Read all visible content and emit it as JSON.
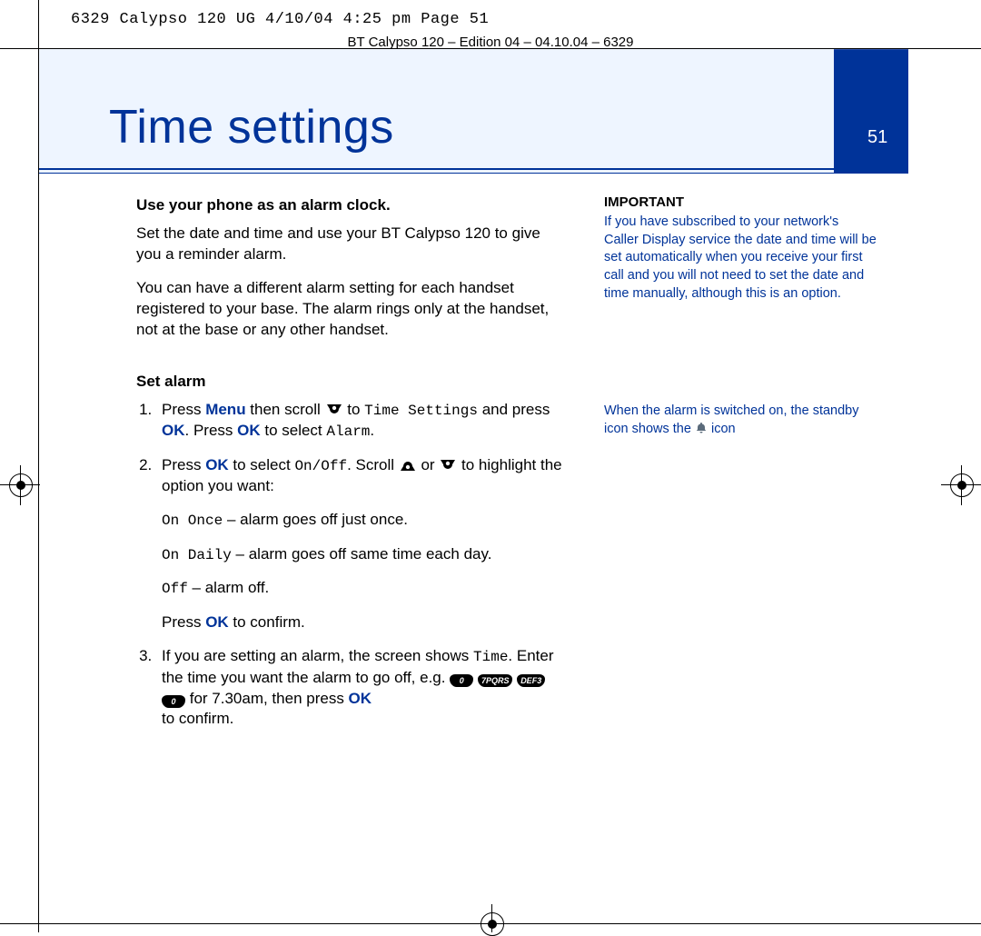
{
  "slug": "6329 Calypso 120 UG   4/10/04  4:25 pm  Page 51",
  "running_head": "BT Calypso 120 – Edition 04 – 04.10.04 – 6329",
  "banner": {
    "title": "Time settings",
    "page_number": "51"
  },
  "main": {
    "h1": "Use your phone as an alarm clock.",
    "p1": "Set the date and time and use your BT Calypso 120 to give you a reminder alarm.",
    "p2": "You can have a different alarm setting for each handset registered to your base. The alarm rings only at the handset, not at the base or any other handset.",
    "h2": "Set alarm",
    "step1_a": "Press ",
    "step1_menu": "Menu",
    "step1_b": " then scroll ",
    "step1_c": " to ",
    "step1_menu_item": "Time Settings",
    "step1_d": " and press ",
    "step1_ok1": "OK",
    "step1_e": ". Press ",
    "step1_ok2": "OK",
    "step1_f": " to select ",
    "step1_alarm": "Alarm",
    "step1_g": ".",
    "step2_a": "Press ",
    "step2_ok": "OK",
    "step2_b": " to select ",
    "step2_onoff": "On/Off",
    "step2_c": ". Scroll ",
    "step2_d": " or ",
    "step2_e": " to highlight the option you want:",
    "opt1_label": "On Once",
    "opt1_text": " – alarm goes off just once.",
    "opt2_label": "On Daily",
    "opt2_text": " – alarm goes off same time each day.",
    "opt3_label": "Off",
    "opt3_text": " – alarm off.",
    "step2_press": "Press ",
    "step2_ok2": "OK",
    "step2_confirm": " to confirm.",
    "step3_a": "If you are setting an alarm, the screen shows ",
    "step3_time": "Time",
    "step3_b": ". Enter the time you want the alarm to go off, e.g. ",
    "key0a": "0",
    "key7": "7PQRS",
    "key3": "DEF3",
    "key0b": "0",
    "step3_c": " for 7.30am, then press ",
    "step3_ok": "OK",
    "step3_d": " to confirm."
  },
  "side": {
    "heading": "IMPORTANT",
    "text": "If you have subscribed to your network's Caller Display service the date and time will be set automatically when you receive your first call and you will not need to set the date and time manually, although this is an option.",
    "note_a": "When the alarm is switched on, the standby icon shows the ",
    "note_b": " icon"
  }
}
